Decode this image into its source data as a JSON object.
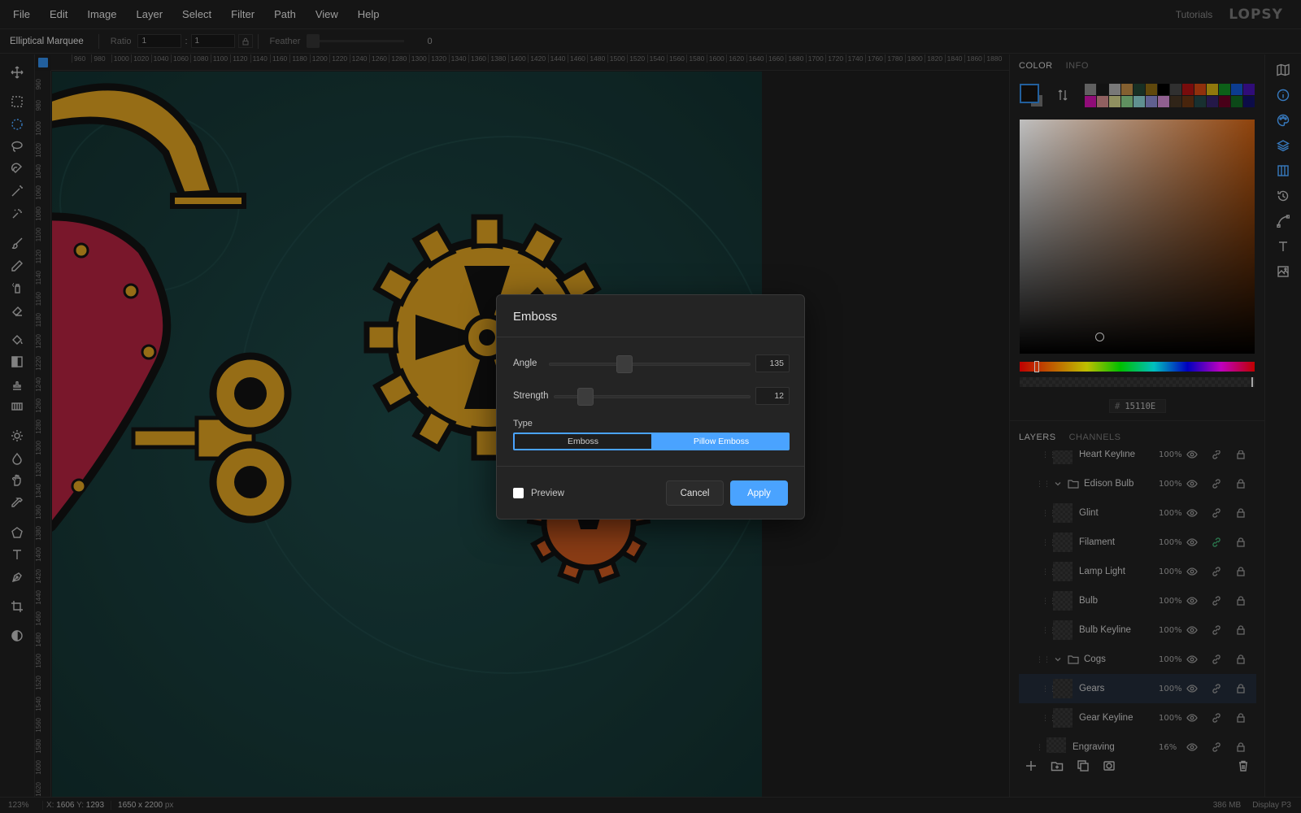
{
  "menubar": {
    "items": [
      "File",
      "Edit",
      "Image",
      "Layer",
      "Select",
      "Filter",
      "Path",
      "View",
      "Help"
    ],
    "tutorials": "Tutorials",
    "logo": "LOPSY"
  },
  "options": {
    "tool_name": "Elliptical Marquee",
    "ratio_label": "Ratio",
    "ratio_w": "1",
    "ratio_sep": ":",
    "ratio_h": "1",
    "feather_label": "Feather",
    "feather_value": "0"
  },
  "rulers": {
    "top": [
      "960",
      "980",
      "1000",
      "1020",
      "1040",
      "1060",
      "1080",
      "1100",
      "1120",
      "1140",
      "1160",
      "1180",
      "1200",
      "1220",
      "1240",
      "1260",
      "1280",
      "1300",
      "1320",
      "1340",
      "1360",
      "1380",
      "1400",
      "1420",
      "1440",
      "1460",
      "1480",
      "1500",
      "1520",
      "1540",
      "1560",
      "1580",
      "1600",
      "1620",
      "1640",
      "1660",
      "1680",
      "1700",
      "1720",
      "1740",
      "1760",
      "1780",
      "1800",
      "1820",
      "1840",
      "1860",
      "1880"
    ],
    "left": [
      "960",
      "980",
      "1000",
      "1020",
      "1040",
      "1060",
      "1080",
      "1100",
      "1120",
      "1140",
      "1160",
      "1180",
      "1200",
      "1220",
      "1240",
      "1260",
      "1280",
      "1300",
      "1320",
      "1340",
      "1360",
      "1380",
      "1400",
      "1420",
      "1440",
      "1460",
      "1480",
      "1500",
      "1520",
      "1540",
      "1560",
      "1580",
      "1600",
      "1620"
    ]
  },
  "color_panel": {
    "tabs": [
      "COLOR",
      "INFO"
    ],
    "palette": [
      "#808080",
      "#1a1a1a",
      "#a0a0a0",
      "#b08040",
      "#204030",
      "#806010",
      "#000000",
      "#404040",
      "#a01010",
      "#c04010",
      "#c0a010",
      "#108020",
      "#1050c0",
      "#4010a0",
      "#c010a0",
      "#c08080",
      "#c0c080",
      "#80c080",
      "#80c0c0",
      "#8080c0",
      "#c080c0",
      "#403020",
      "#603010",
      "#204040",
      "#302060",
      "#600020",
      "#106020",
      "#101060"
    ],
    "hex_prefix": "#",
    "hex_value": "15110E",
    "fg_color": "#15110e",
    "hue_color": "#c05a10"
  },
  "layers_panel": {
    "tabs": [
      "LAYERS",
      "CHANNELS"
    ],
    "layers": [
      {
        "name": "Heart Keyline",
        "opacity": "100%",
        "kind": "layer",
        "indent": 1,
        "lock": true,
        "link_green": false,
        "selected": false
      },
      {
        "name": "Edison Bulb",
        "opacity": "100%",
        "kind": "group",
        "indent": 0,
        "lock": true,
        "link_green": false,
        "selected": false
      },
      {
        "name": "Glint",
        "opacity": "100%",
        "kind": "layer",
        "indent": 1,
        "lock": true,
        "link_green": false,
        "selected": false
      },
      {
        "name": "Filament",
        "opacity": "100%",
        "kind": "layer",
        "indent": 1,
        "lock": true,
        "link_green": true,
        "selected": false
      },
      {
        "name": "Lamp Light",
        "opacity": "100%",
        "kind": "layer",
        "indent": 1,
        "lock": true,
        "link_green": false,
        "selected": false
      },
      {
        "name": "Bulb",
        "opacity": "100%",
        "kind": "layer",
        "indent": 1,
        "lock": true,
        "link_green": false,
        "selected": false
      },
      {
        "name": "Bulb Keyline",
        "opacity": "100%",
        "kind": "layer",
        "indent": 1,
        "lock": true,
        "link_green": false,
        "selected": false
      },
      {
        "name": "Cogs",
        "opacity": "100%",
        "kind": "group",
        "indent": 0,
        "lock": true,
        "link_green": false,
        "selected": false
      },
      {
        "name": "Gears",
        "opacity": "100%",
        "kind": "layer",
        "indent": 1,
        "lock": true,
        "link_green": false,
        "selected": true
      },
      {
        "name": "Gear Keyline",
        "opacity": "100%",
        "kind": "layer",
        "indent": 1,
        "lock": true,
        "link_green": false,
        "selected": false
      },
      {
        "name": "Engraving",
        "opacity": "16%",
        "kind": "layer",
        "indent": 0,
        "lock": true,
        "link_green": false,
        "selected": false
      }
    ]
  },
  "statusbar": {
    "zoom": "123%",
    "x_label": "X:",
    "x_value": "1606",
    "y_label": "Y:",
    "y_value": "1293",
    "dims": "1650 x 2200",
    "dims_unit": "px",
    "memory": "386 MB",
    "profile": "Display P3"
  },
  "dialog": {
    "title": "Emboss",
    "angle_label": "Angle",
    "angle_value": "135",
    "angle_fraction": 0.375,
    "strength_label": "Strength",
    "strength_value": "12",
    "strength_fraction": 0.12,
    "type_label": "Type",
    "type_options": [
      "Emboss",
      "Pillow Emboss"
    ],
    "type_selected": "Pillow Emboss",
    "preview_label": "Preview",
    "preview_checked": false,
    "cancel_label": "Cancel",
    "apply_label": "Apply"
  }
}
